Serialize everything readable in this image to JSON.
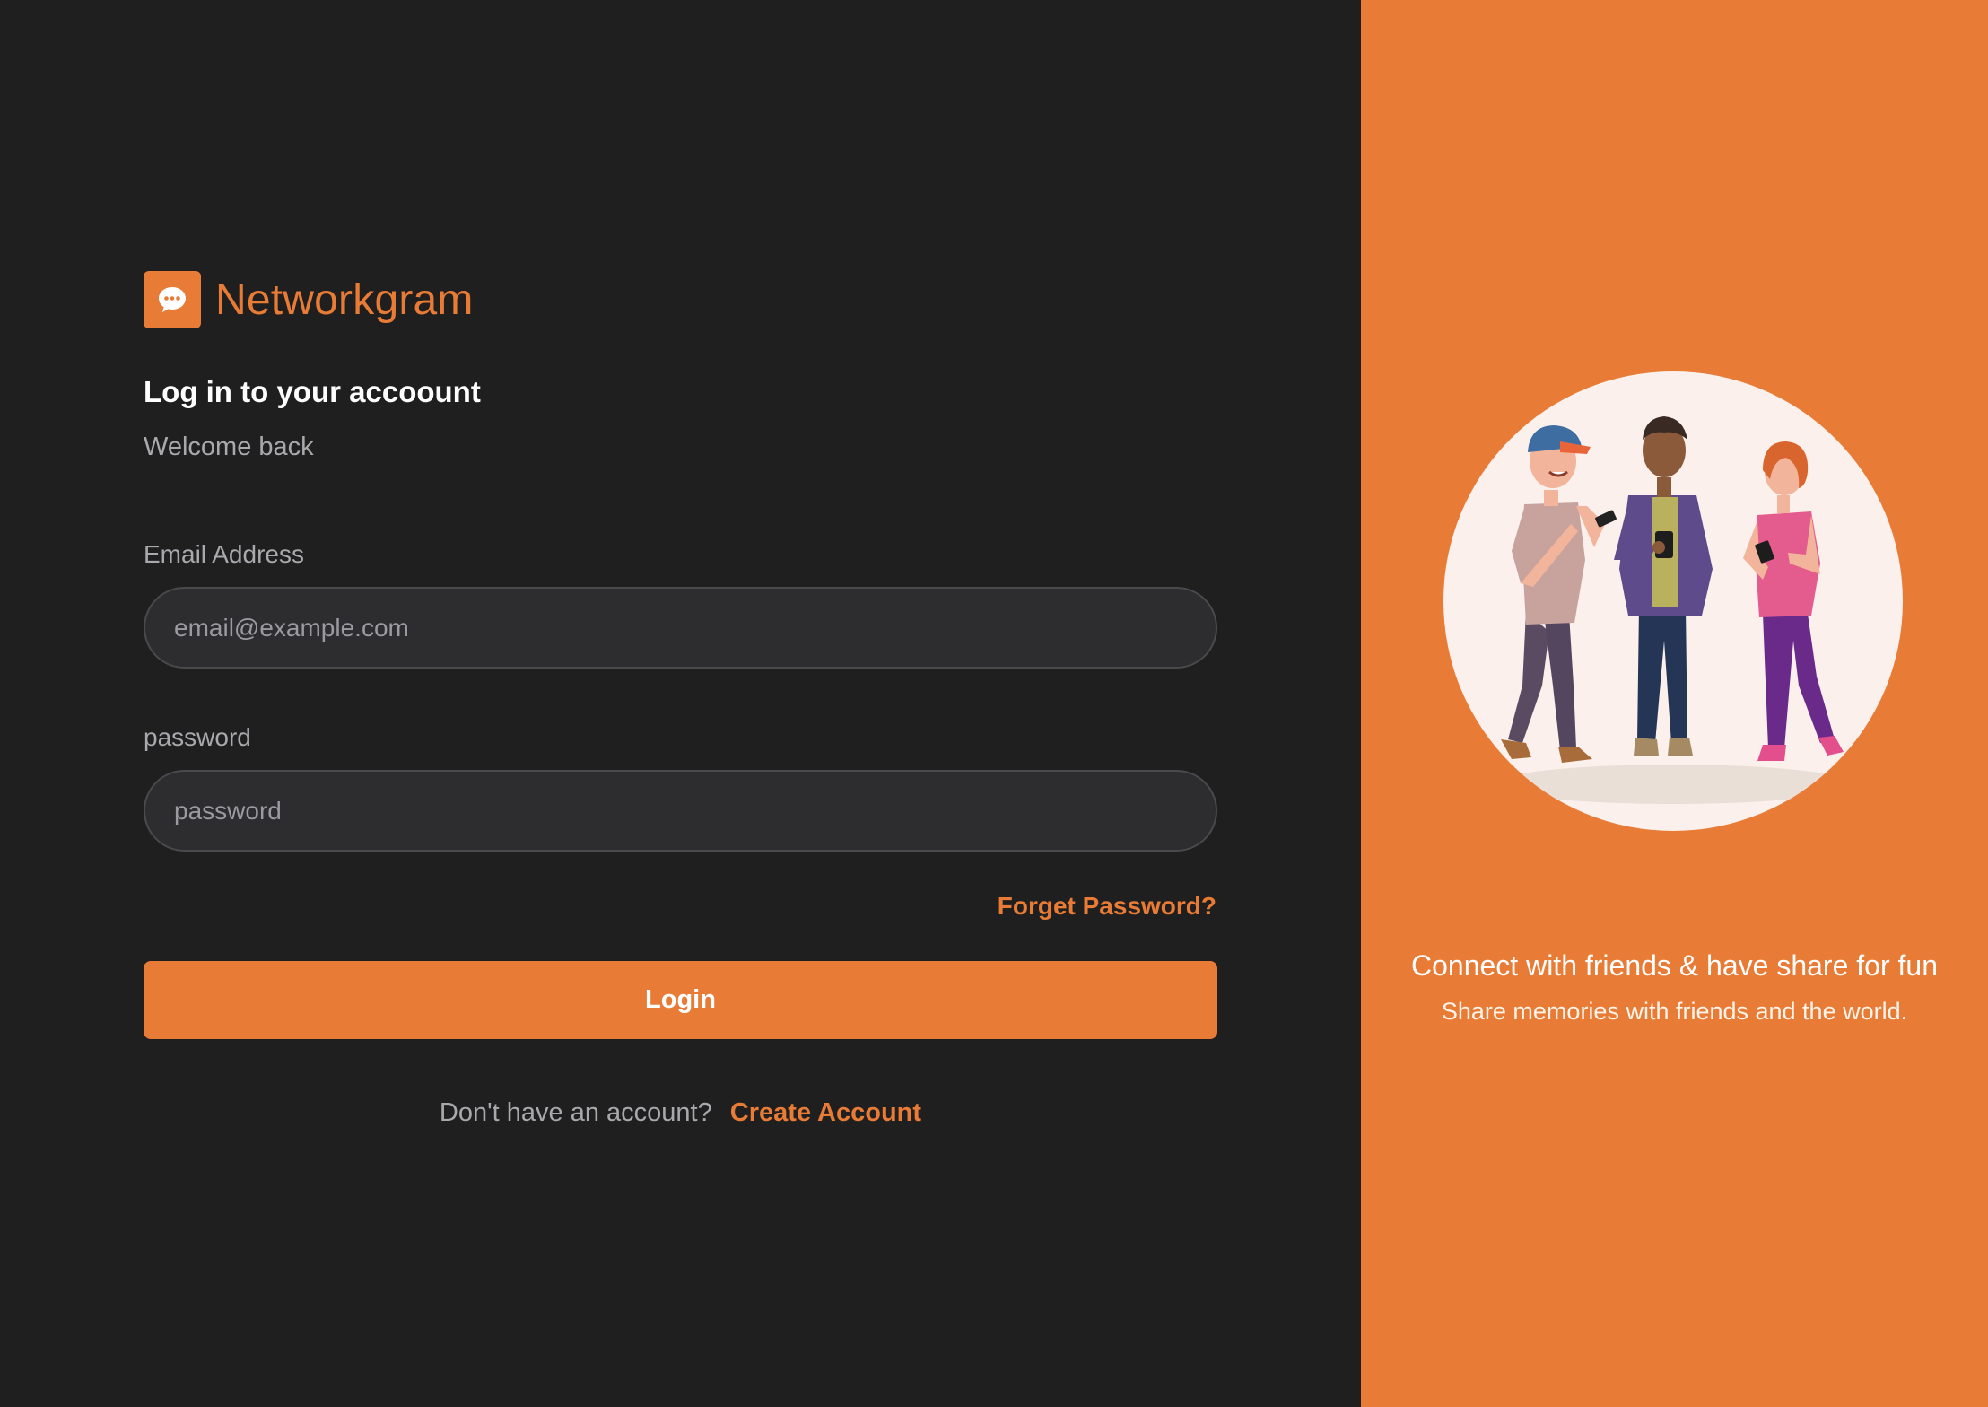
{
  "brand": {
    "name": "Networkgram",
    "logo_icon": "chat-bubble-icon"
  },
  "login": {
    "title": "Log in to your accoount",
    "subtitle": "Welcome back",
    "email_label": "Email Address",
    "email_placeholder": "email@example.com",
    "email_value": "",
    "password_label": "password",
    "password_placeholder": "password",
    "password_value": "",
    "forgot_label": "Forget Password?",
    "button_label": "Login",
    "no_account_text": "Don't have an account?",
    "create_account_label": "Create Account"
  },
  "promo": {
    "tagline": "Connect with friends & have share for fun",
    "subtagline": "Share memories with friends and the world.",
    "illustration": "three-friends-with-phones-illustration"
  },
  "colors": {
    "accent": "#e87b35",
    "background": "#1f1f1f",
    "input_background": "#2d2c2f",
    "muted_text": "#a9a9ad",
    "illustration_circle": "#fbf0ec"
  }
}
